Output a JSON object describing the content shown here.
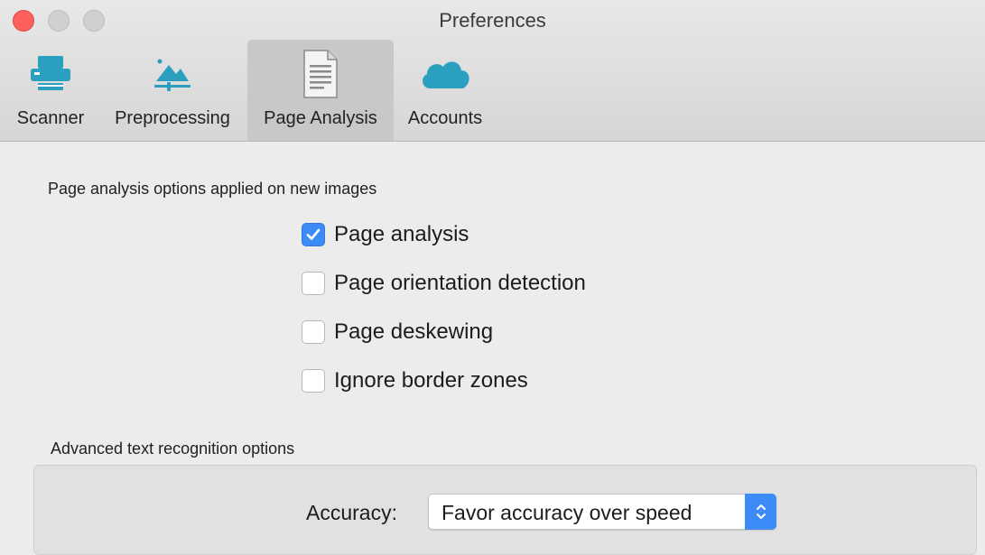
{
  "window": {
    "title": "Preferences"
  },
  "toolbar": {
    "tabs": [
      {
        "label": "Scanner",
        "icon": "scanner-icon",
        "selected": false
      },
      {
        "label": "Preprocessing",
        "icon": "image-adjust-icon",
        "selected": false
      },
      {
        "label": "Page Analysis",
        "icon": "document-icon",
        "selected": true
      },
      {
        "label": "Accounts",
        "icon": "cloud-icon",
        "selected": false
      }
    ]
  },
  "page_analysis": {
    "section_title": "Page analysis options applied on new images",
    "options": [
      {
        "label": "Page analysis",
        "checked": true
      },
      {
        "label": "Page orientation detection",
        "checked": false
      },
      {
        "label": "Page deskewing",
        "checked": false
      },
      {
        "label": "Ignore border zones",
        "checked": false
      }
    ]
  },
  "advanced": {
    "section_title": "Advanced text recognition options",
    "accuracy_label": "Accuracy:",
    "accuracy_value": "Favor accuracy over speed"
  },
  "colors": {
    "accent": "#3d8bf7",
    "icon_teal": "#2a9fbf",
    "close_button": "#fc605c"
  }
}
